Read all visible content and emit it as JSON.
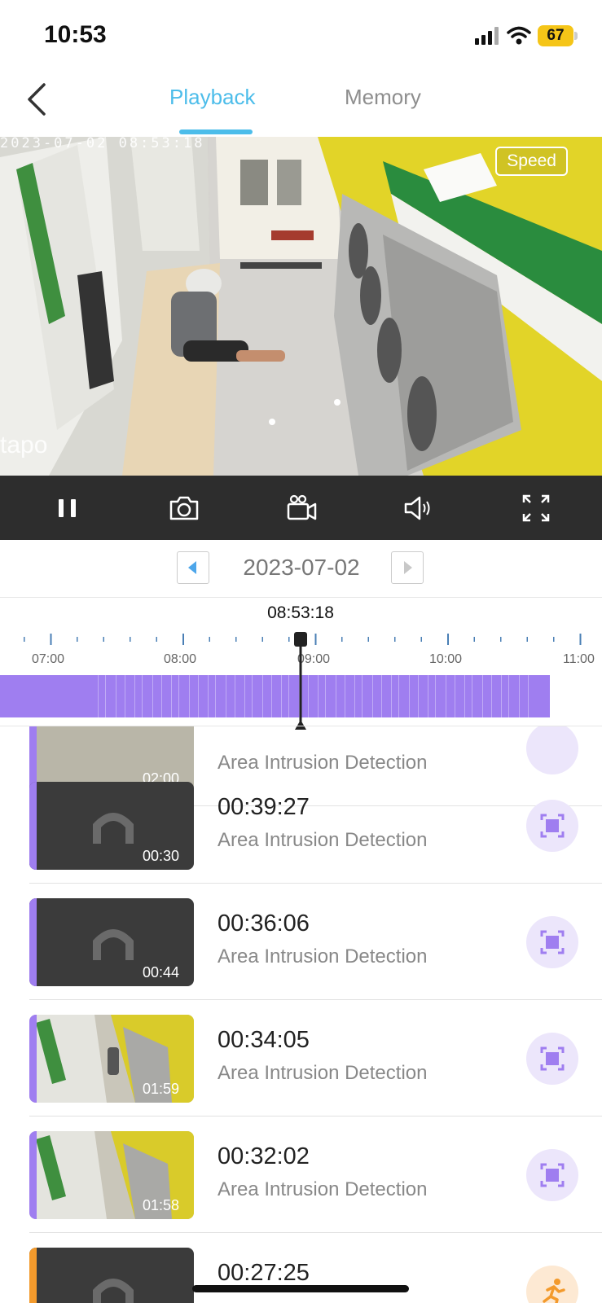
{
  "status": {
    "time": "10:53",
    "battery": "67"
  },
  "header": {
    "tabs": [
      {
        "label": "Playback"
      },
      {
        "label": "Memory"
      }
    ]
  },
  "video": {
    "timestamp": "2023-07-02 08:53:18",
    "watermark": "tapo",
    "speed_label": "Speed"
  },
  "controls": {
    "icons": [
      "pause-icon",
      "camera-icon",
      "record-icon",
      "speaker-icon",
      "fullscreen-icon"
    ]
  },
  "date_nav": {
    "date": "2023-07-02"
  },
  "timeline": {
    "current_time": "08:53:18",
    "labels": [
      "07:00",
      "08:00",
      "09:00",
      "10:00",
      "11:00"
    ]
  },
  "events": [
    {
      "time": "",
      "type": "Area Intrusion Detection",
      "duration": "02:00"
    },
    {
      "time": "00:39:27",
      "type": "Area Intrusion Detection",
      "duration": "00:30"
    },
    {
      "time": "00:36:06",
      "type": "Area Intrusion Detection",
      "duration": "00:44"
    },
    {
      "time": "00:34:05",
      "type": "Area Intrusion Detection",
      "duration": "01:59"
    },
    {
      "time": "00:32:02",
      "type": "Area Intrusion Detection",
      "duration": "01:58"
    },
    {
      "time": "00:27:25",
      "type": "",
      "duration": ""
    }
  ],
  "colors": {
    "accent": "#4dbdea",
    "recording": "#9f7ef0",
    "person_event": "#f39a2c"
  }
}
